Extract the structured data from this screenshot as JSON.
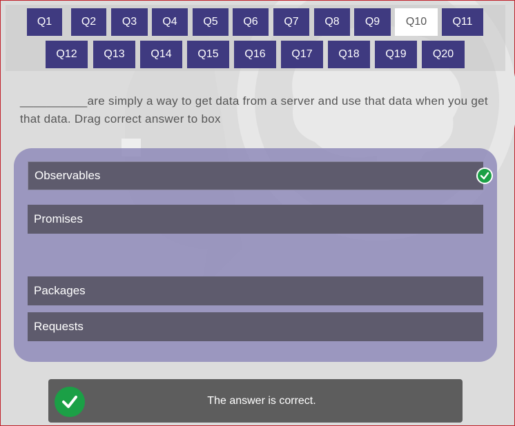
{
  "quiz_nav": {
    "questions": [
      "Q1",
      "Q2",
      "Q3",
      "Q4",
      "Q5",
      "Q6",
      "Q7",
      "Q8",
      "Q9",
      "Q10",
      "Q11",
      "Q12",
      "Q13",
      "Q14",
      "Q15",
      "Q16",
      "Q17",
      "Q18",
      "Q19",
      "Q20"
    ],
    "active": "Q10"
  },
  "question": {
    "text": "__________are simply a way to get data from a server and use that data when you get that data. Drag correct answer to box"
  },
  "answers": {
    "placed": "Observables",
    "options": [
      "Promises",
      "Packages",
      "Requests"
    ]
  },
  "feedback": {
    "text": "The answer is correct."
  },
  "colors": {
    "nav_button": "#3f3a80",
    "answer_bg": "#5e5b6d",
    "panel_bg": "#8c88b8",
    "correct_green": "#1ba046",
    "feedback_bg": "#5d5d5d"
  }
}
